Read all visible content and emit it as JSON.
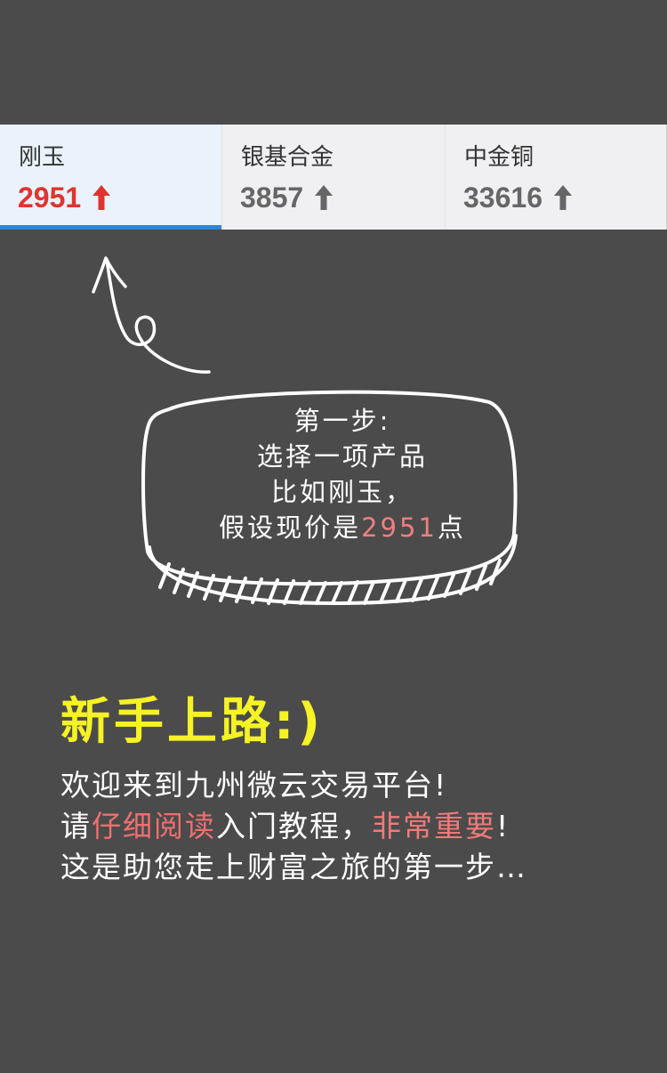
{
  "products": [
    {
      "name": "刚玉",
      "price": "2951",
      "trend": "up",
      "selected": true
    },
    {
      "name": "银基合金",
      "price": "3857",
      "trend": "up",
      "selected": false
    },
    {
      "name": "中金铜",
      "price": "33616",
      "trend": "up",
      "selected": false
    }
  ],
  "colors": {
    "background": "#4b4b4b",
    "selected_price": "#e0342e",
    "normal_price": "#666666",
    "tab_underline": "#2f86d6",
    "headline": "#f5f225",
    "highlight": "#ef6f6f"
  },
  "bubble": {
    "line1": "第一步:",
    "line2": "选择一项产品",
    "line3": "比如刚玉，",
    "line4_pre": "假设现价是",
    "line4_num": "2951",
    "line4_post": "点"
  },
  "headline": "新手上路:)",
  "intro": {
    "line1": "欢迎来到九州微云交易平台!",
    "line2_pre": "请",
    "line2_hl1": "仔细阅读",
    "line2_mid": "入门教程，",
    "line2_hl2": "非常重要",
    "line2_post": "!",
    "line3": "这是助您走上财富之旅的第一步…"
  }
}
